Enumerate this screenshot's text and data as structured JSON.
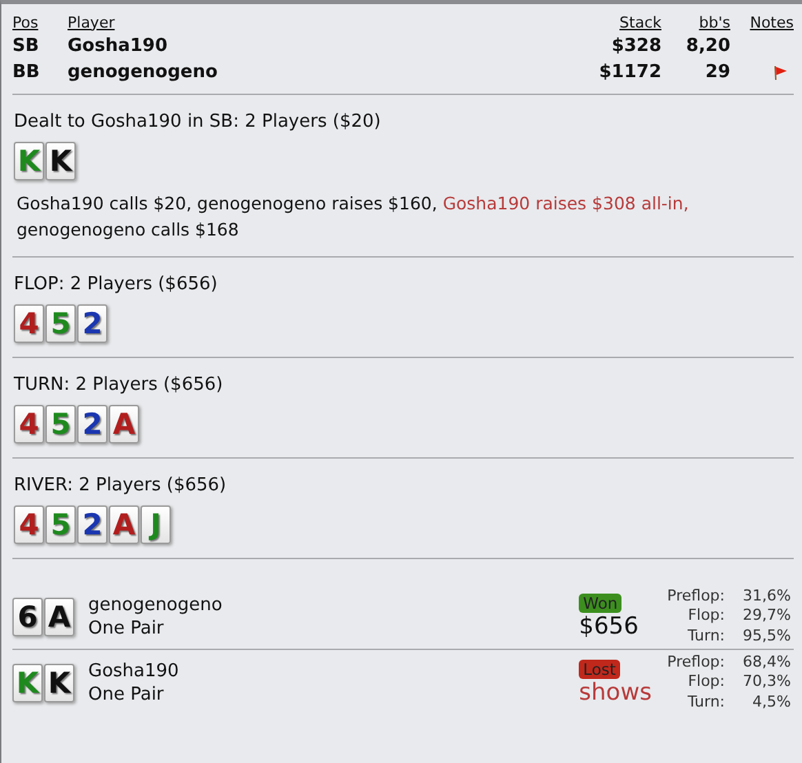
{
  "players_table": {
    "columns": [
      "Pos",
      "Player",
      "Stack",
      "bb's",
      "Notes"
    ],
    "rows": [
      {
        "pos": "SB",
        "player": "Gosha190",
        "stack": "$328",
        "bbs": "8,20",
        "note": false
      },
      {
        "pos": "BB",
        "player": "genogenogeno",
        "stack": "$1172",
        "bbs": "29",
        "note": true
      }
    ]
  },
  "streets": [
    {
      "title": "Dealt to Gosha190 in SB: 2 Players ($20)",
      "cards": [
        {
          "rank": "K",
          "color": "#1e8a1e"
        },
        {
          "rank": "K",
          "color": "#111111"
        }
      ],
      "actions": [
        {
          "text": "Gosha190 calls $20, genogenogeno raises $160, ",
          "highlight": false
        },
        {
          "text": "Gosha190 raises $308 all-in,",
          "highlight": true
        },
        {
          "text": " genogenogeno calls $168",
          "highlight": false
        }
      ]
    },
    {
      "title": "FLOP: 2 Players ($656)",
      "cards": [
        {
          "rank": "4",
          "color": "#b21e1e"
        },
        {
          "rank": "5",
          "color": "#1e8a1e"
        },
        {
          "rank": "2",
          "color": "#1a36b0"
        }
      ]
    },
    {
      "title": "TURN: 2 Players ($656)",
      "cards": [
        {
          "rank": "4",
          "color": "#b21e1e"
        },
        {
          "rank": "5",
          "color": "#1e8a1e"
        },
        {
          "rank": "2",
          "color": "#1a36b0"
        },
        {
          "rank": "A",
          "color": "#b21e1e"
        }
      ]
    },
    {
      "title": "RIVER: 2 Players ($656)",
      "cards": [
        {
          "rank": "4",
          "color": "#b21e1e"
        },
        {
          "rank": "5",
          "color": "#1e8a1e"
        },
        {
          "rank": "2",
          "color": "#1a36b0"
        },
        {
          "rank": "A",
          "color": "#b21e1e"
        },
        {
          "rank": "J",
          "color": "#1e8a1e"
        }
      ]
    }
  ],
  "showdown": [
    {
      "cards": [
        {
          "rank": "6",
          "color": "#111111"
        },
        {
          "rank": "A",
          "color": "#111111"
        }
      ],
      "player": "genogenogeno",
      "hand": "One Pair",
      "kind": "won",
      "badge": "Won",
      "result": "$656",
      "equity": [
        {
          "label": "Preflop:",
          "value": "31,6%"
        },
        {
          "label": "Flop:",
          "value": "29,7%"
        },
        {
          "label": "Turn:",
          "value": "95,5%"
        }
      ]
    },
    {
      "cards": [
        {
          "rank": "K",
          "color": "#1e8a1e"
        },
        {
          "rank": "K",
          "color": "#111111"
        }
      ],
      "player": "Gosha190",
      "hand": "One Pair",
      "kind": "lost",
      "badge": "Lost",
      "result": "shows",
      "equity": [
        {
          "label": "Preflop:",
          "value": "68,4%"
        },
        {
          "label": "Flop:",
          "value": "70,3%"
        },
        {
          "label": "Turn:",
          "value": "4,5%"
        }
      ]
    }
  ]
}
